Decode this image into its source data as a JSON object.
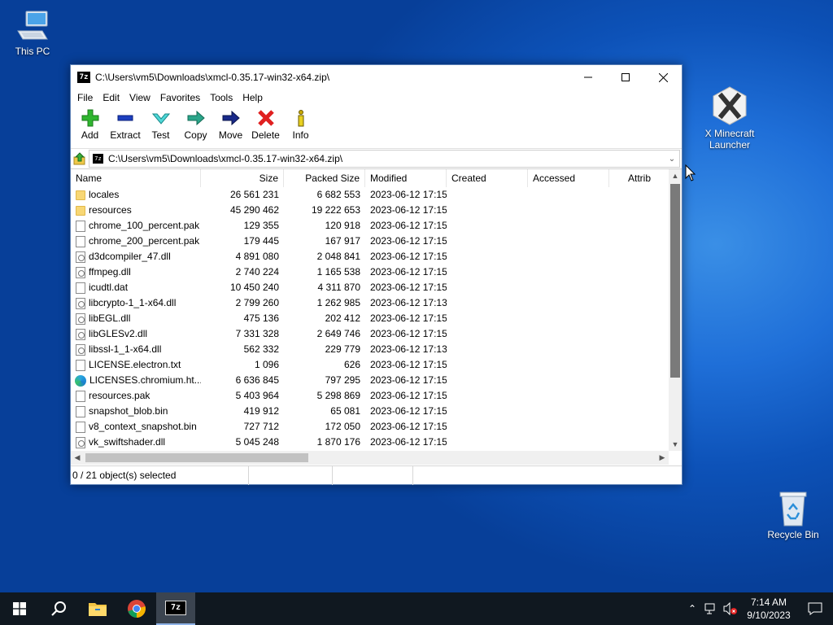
{
  "desktop": {
    "icons": {
      "this_pc": "This PC",
      "xmcl_line1": "X Minecraft",
      "xmcl_line2": "Launcher",
      "recycle_bin": "Recycle Bin"
    }
  },
  "window": {
    "title": "C:\\Users\\vm5\\Downloads\\xmcl-0.35.17-win32-x64.zip\\",
    "app_icon_text": "7z",
    "menu": [
      "File",
      "Edit",
      "View",
      "Favorites",
      "Tools",
      "Help"
    ],
    "toolbar": {
      "add": "Add",
      "extract": "Extract",
      "test": "Test",
      "copy": "Copy",
      "move": "Move",
      "delete": "Delete",
      "info": "Info"
    },
    "address": "C:\\Users\\vm5\\Downloads\\xmcl-0.35.17-win32-x64.zip\\",
    "columns": {
      "name": "Name",
      "size": "Size",
      "packed": "Packed Size",
      "modified": "Modified",
      "created": "Created",
      "accessed": "Accessed",
      "attrib": "Attrib"
    },
    "files": [
      {
        "name": "locales",
        "size": "26 561 231",
        "packed": "6 682 553",
        "modified": "2023-06-12 17:15",
        "type": "folder"
      },
      {
        "name": "resources",
        "size": "45 290 462",
        "packed": "19 222 653",
        "modified": "2023-06-12 17:15",
        "type": "folder"
      },
      {
        "name": "chrome_100_percent.pak",
        "size": "129 355",
        "packed": "120 918",
        "modified": "2023-06-12 17:15",
        "type": "file"
      },
      {
        "name": "chrome_200_percent.pak",
        "size": "179 445",
        "packed": "167 917",
        "modified": "2023-06-12 17:15",
        "type": "file"
      },
      {
        "name": "d3dcompiler_47.dll",
        "size": "4 891 080",
        "packed": "2 048 841",
        "modified": "2023-06-12 17:15",
        "type": "dll"
      },
      {
        "name": "ffmpeg.dll",
        "size": "2 740 224",
        "packed": "1 165 538",
        "modified": "2023-06-12 17:15",
        "type": "dll"
      },
      {
        "name": "icudtl.dat",
        "size": "10 450 240",
        "packed": "4 311 870",
        "modified": "2023-06-12 17:15",
        "type": "file"
      },
      {
        "name": "libcrypto-1_1-x64.dll",
        "size": "2 799 260",
        "packed": "1 262 985",
        "modified": "2023-06-12 17:13",
        "type": "dll"
      },
      {
        "name": "libEGL.dll",
        "size": "475 136",
        "packed": "202 412",
        "modified": "2023-06-12 17:15",
        "type": "dll"
      },
      {
        "name": "libGLESv2.dll",
        "size": "7 331 328",
        "packed": "2 649 746",
        "modified": "2023-06-12 17:15",
        "type": "dll"
      },
      {
        "name": "libssl-1_1-x64.dll",
        "size": "562 332",
        "packed": "229 779",
        "modified": "2023-06-12 17:13",
        "type": "dll"
      },
      {
        "name": "LICENSE.electron.txt",
        "size": "1 096",
        "packed": "626",
        "modified": "2023-06-12 17:15",
        "type": "file"
      },
      {
        "name": "LICENSES.chromium.ht...",
        "size": "6 636 845",
        "packed": "797 295",
        "modified": "2023-06-12 17:15",
        "type": "edge"
      },
      {
        "name": "resources.pak",
        "size": "5 403 964",
        "packed": "5 298 869",
        "modified": "2023-06-12 17:15",
        "type": "file"
      },
      {
        "name": "snapshot_blob.bin",
        "size": "419 912",
        "packed": "65 081",
        "modified": "2023-06-12 17:15",
        "type": "file"
      },
      {
        "name": "v8_context_snapshot.bin",
        "size": "727 712",
        "packed": "172 050",
        "modified": "2023-06-12 17:15",
        "type": "file"
      },
      {
        "name": "vk_swiftshader.dll",
        "size": "5 045 248",
        "packed": "1 870 176",
        "modified": "2023-06-12 17:15",
        "type": "dll"
      }
    ],
    "status": "0 / 21 object(s) selected"
  },
  "taskbar": {
    "clock_time": "7:14 AM",
    "clock_date": "9/10/2023",
    "pinned": [
      "start-button",
      "search",
      "file-explorer",
      "chrome",
      "7-zip"
    ],
    "active_app_label": "7z"
  },
  "colors": {
    "desktop": "#0d52b8",
    "taskbar": "#101820",
    "add_green": "#2fb52f",
    "delete_red": "#e02020"
  }
}
